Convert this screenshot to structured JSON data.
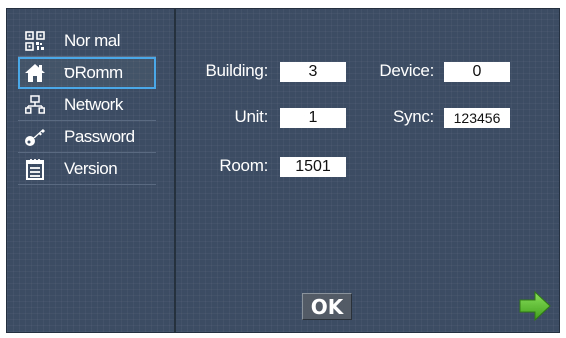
{
  "sidebar": {
    "items": [
      {
        "label": "Nor mal",
        "icon": "qr-code-icon"
      },
      {
        "label": "סRomm",
        "icon": "home-icon"
      },
      {
        "label": "Network",
        "icon": "network-icon"
      },
      {
        "label": "Password",
        "icon": "key-icon"
      },
      {
        "label": "Version",
        "icon": "calendar-list-icon"
      }
    ],
    "active_index": 1
  },
  "fields": {
    "building": {
      "label": "Building:",
      "value": "3"
    },
    "device": {
      "label": "Device:",
      "value": "0"
    },
    "unit": {
      "label": "Unit:",
      "value": "1"
    },
    "sync": {
      "label": "Sync:",
      "value": "123456"
    },
    "room": {
      "label": "Room:",
      "value": "1501"
    }
  },
  "footer": {
    "ok_label": "OK",
    "next_icon": "arrow-right-icon"
  },
  "colors": {
    "panel": "#3c4c62",
    "active_border": "#4aa8e8",
    "arrow": "#5cbf2a"
  }
}
